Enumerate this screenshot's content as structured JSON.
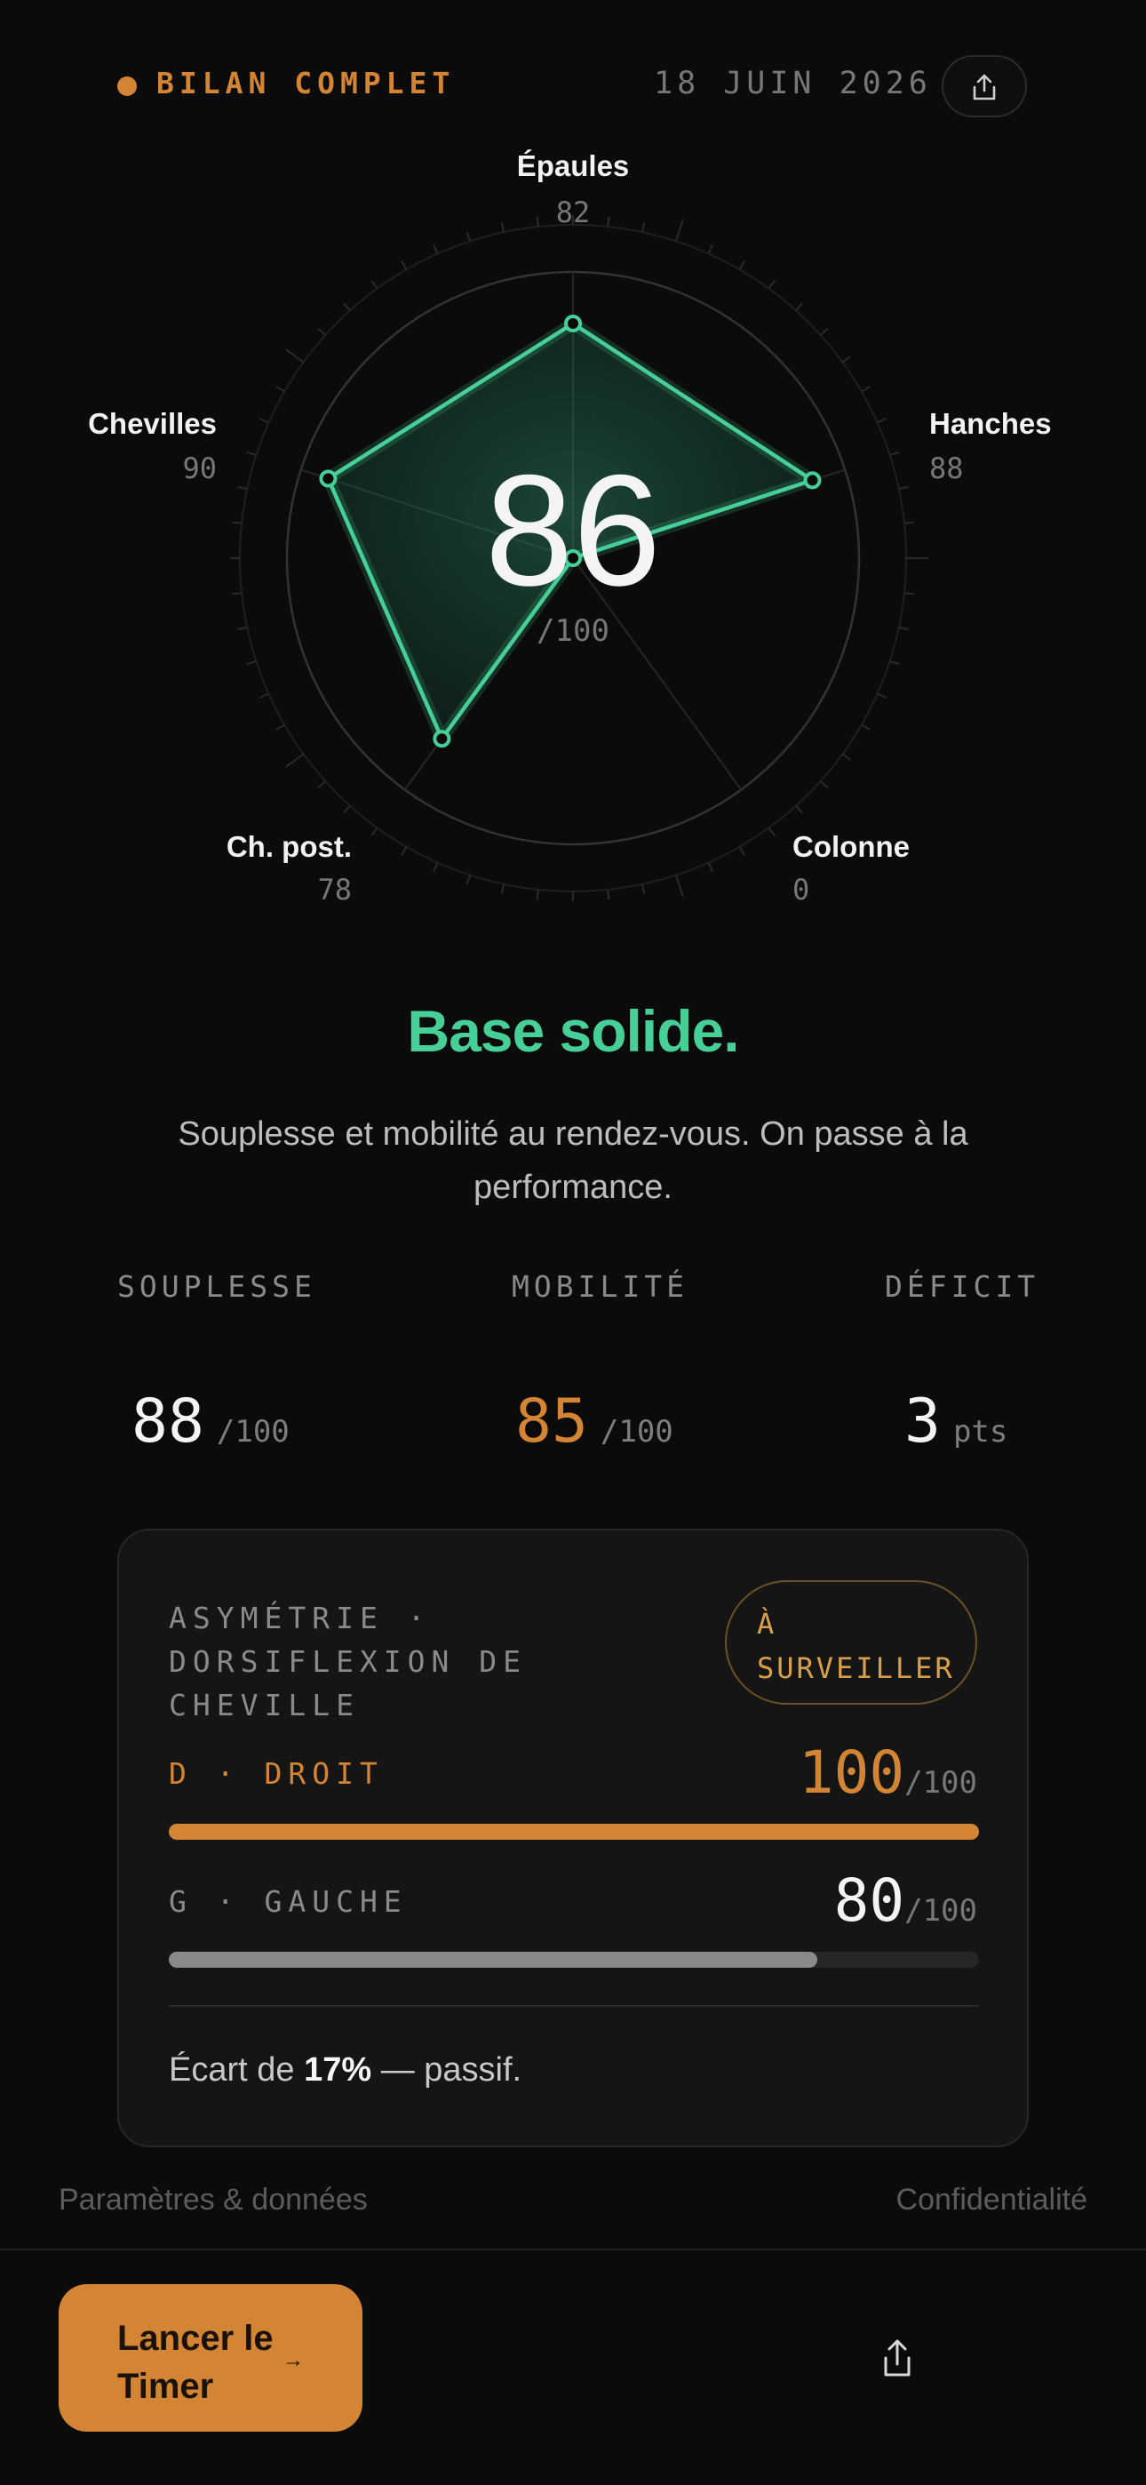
{
  "header": {
    "title": "BILAN COMPLET",
    "date": "18 JUIN 2026",
    "share_icon": "share-icon"
  },
  "radar": {
    "score": "86",
    "score_unit": "/100",
    "max": 100,
    "axes": [
      {
        "label": "Épaules",
        "value": 82
      },
      {
        "label": "Hanches",
        "value": 88
      },
      {
        "label": "Colonne",
        "value": 0
      },
      {
        "label": "Ch. post.",
        "value": 78
      },
      {
        "label": "Chevilles",
        "value": 90
      }
    ],
    "accent": "#46cf97"
  },
  "verdict": {
    "title": "Base solide.",
    "subtitle": "Souplesse et mobilité au rendez-vous. On passe à la performance."
  },
  "stats": [
    {
      "label": "SOUPLESSE",
      "value": "88",
      "unit": "/100",
      "color": "#f4f4f4"
    },
    {
      "label": "MOBILITÉ",
      "value": "85",
      "unit": "/100",
      "color": "#d38534"
    },
    {
      "label": "DÉFICIT",
      "value": "3",
      "unit": "pts",
      "color": "#f4f4f4"
    }
  ],
  "asymmetry": {
    "title": "ASYMÉTRIE · DORSIFLEXION DE CHEVILLE",
    "badge": "À SURVEILLER",
    "right": {
      "label": "D · DROIT",
      "value": "100",
      "unit": "/100",
      "fraction": 1.0,
      "color": "#d38534"
    },
    "left": {
      "label": "G · GAUCHE",
      "value": "80",
      "unit": "/100",
      "fraction": 0.8,
      "color": "#8a8a8a"
    },
    "footer_prefix": "Écart de ",
    "footer_value": "17%",
    "footer_suffix": " — passif."
  },
  "footer": {
    "settings_link": "Paramètres & données",
    "privacy_link": "Confidentialité",
    "cta_label": "Lancer le Timer",
    "cta_arrow": "→",
    "share_icon": "share-icon"
  },
  "colors": {
    "accent_orange": "#d38534",
    "accent_green": "#46cf97",
    "background": "#0b0b0b"
  }
}
